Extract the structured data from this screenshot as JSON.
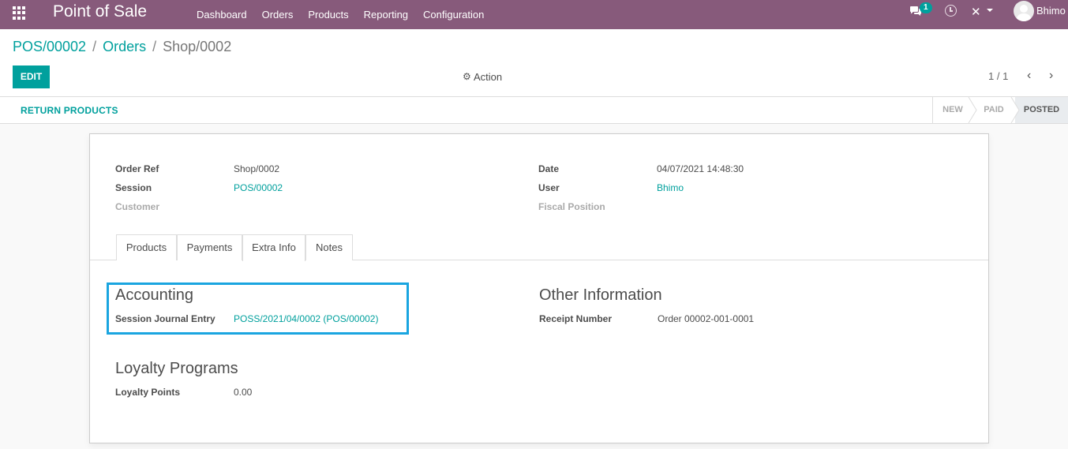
{
  "navbar": {
    "app_title": "Point of Sale",
    "menu": [
      "Dashboard",
      "Orders",
      "Products",
      "Reporting",
      "Configuration"
    ],
    "chat_count": "1",
    "username": "Bhimo",
    "debug_glyph": "✕"
  },
  "breadcrumb": [
    "POS/00002",
    "Orders",
    "Shop/0002"
  ],
  "breadcrumb_sep": "/",
  "toolbar": {
    "edit_label": "EDIT",
    "action_label": "Action",
    "pager": "1 / 1",
    "prev_glyph": "‹",
    "next_glyph": "›"
  },
  "statusbar": {
    "return_label": "RETURN PRODUCTS",
    "stages": [
      "NEW",
      "PAID",
      "POSTED"
    ],
    "active_stage": "POSTED"
  },
  "form": {
    "order_ref_label": "Order Ref",
    "order_ref": "Shop/0002",
    "session_label": "Session",
    "session": "POS/00002",
    "customer_label": "Customer",
    "date_label": "Date",
    "date": "04/07/2021 14:48:30",
    "user_label": "User",
    "user": "Bhimo",
    "fiscal_label": "Fiscal Position"
  },
  "tabs": [
    "Products",
    "Payments",
    "Extra Info",
    "Notes"
  ],
  "active_tab": "Extra Info",
  "extra_info": {
    "accounting_title": "Accounting",
    "journal_label": "Session Journal Entry",
    "journal_value": "POSS/2021/04/0002 (POS/00002)",
    "other_title": "Other Information",
    "receipt_label": "Receipt Number",
    "receipt_value": "Order 00002-001-0001",
    "loyalty_title": "Loyalty Programs",
    "loyalty_label": "Loyalty Points",
    "loyalty_value": "0.00"
  },
  "colors": {
    "navbar": "#875a7b",
    "accent": "#00a09d",
    "highlight": "#1aa5e0"
  }
}
